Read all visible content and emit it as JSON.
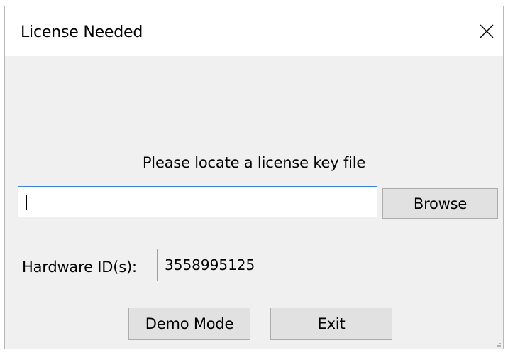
{
  "window": {
    "title": "License Needed",
    "close_icon": "close-icon"
  },
  "prompt": {
    "text": "Please locate a license key file"
  },
  "license_path": {
    "value": ""
  },
  "browse_button": {
    "label": "Browse"
  },
  "hardware": {
    "label": "Hardware ID(s):",
    "value": "3558995125"
  },
  "actions": {
    "demo_label": "Demo Mode",
    "exit_label": "Exit"
  },
  "colors": {
    "window_background": "#f0f0f0",
    "titlebar_background": "#ffffff",
    "focus_border": "#3c84d4",
    "button_background": "#e1e1e1"
  }
}
